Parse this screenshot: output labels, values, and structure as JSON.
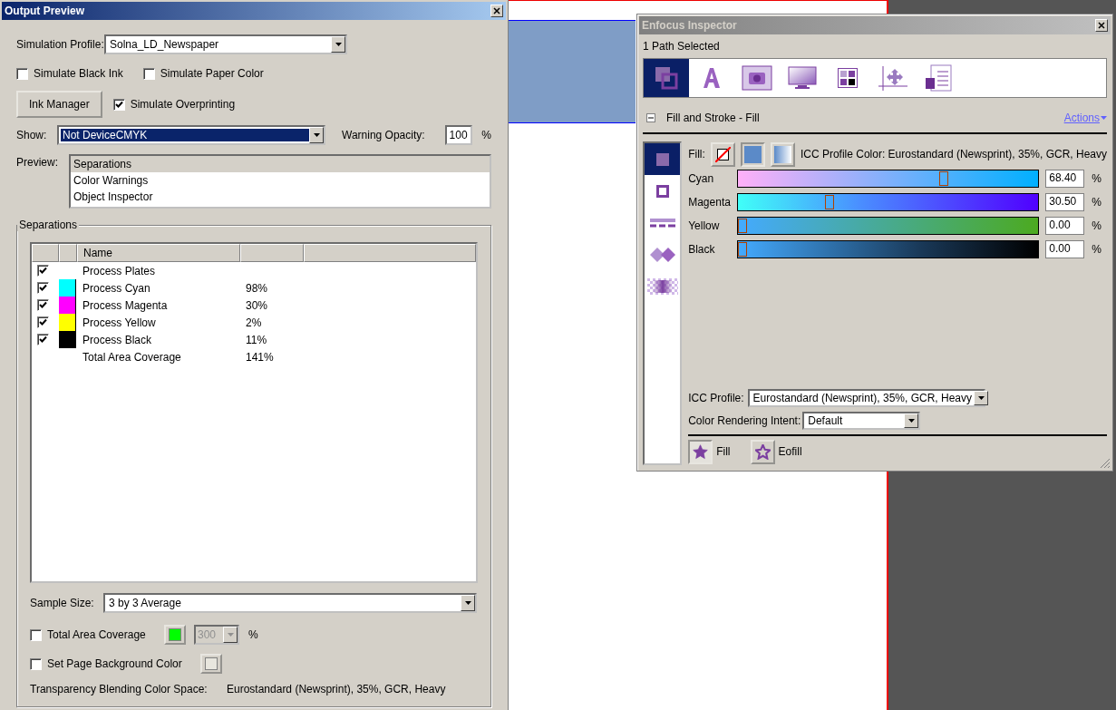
{
  "output_preview": {
    "title": "Output Preview",
    "simulation_profile": {
      "label": "Simulation Profile:",
      "value": "Solna_LD_Newspaper"
    },
    "simulate_options": [
      {
        "label": "Simulate Black Ink",
        "checked": false
      },
      {
        "label": "Simulate Paper Color",
        "checked": false
      }
    ],
    "ink_manager": "Ink Manager",
    "simulate_overprinting": {
      "label": "Simulate Overprinting",
      "checked": true
    },
    "show": {
      "label": "Show:",
      "value": "Not DeviceCMYK"
    },
    "warning_opacity": {
      "label": "Warning Opacity:",
      "value": "100",
      "unit": "%"
    },
    "preview": {
      "label": "Preview:",
      "items": [
        {
          "label": "Separations",
          "selected": true
        },
        {
          "label": "Color Warnings",
          "selected": false
        },
        {
          "label": "Object Inspector",
          "selected": false
        }
      ]
    },
    "separations": {
      "title": "Separations",
      "columns": [
        "Name"
      ],
      "rows": [
        {
          "checked": true,
          "name": "Process Plates",
          "value": ""
        },
        {
          "checked": true,
          "color": "#00ffff",
          "name": "Process Cyan",
          "value": "98%"
        },
        {
          "checked": true,
          "color": "#ff00ff",
          "name": "Process Magenta",
          "value": "30%"
        },
        {
          "checked": true,
          "color": "#ffff00",
          "name": "Process Yellow",
          "value": "2%"
        },
        {
          "checked": true,
          "color": "#000000",
          "name": "Process Black",
          "value": "11%"
        },
        {
          "kind": "total",
          "name": "Total Area Coverage",
          "value": "141%"
        }
      ]
    },
    "sample_size": {
      "label": "Sample Size:",
      "value": "3 by 3 Average"
    },
    "total_area_coverage": {
      "label": "Total Area Coverage",
      "checked": false,
      "color": "#00ff00",
      "value": "300",
      "unit": "%"
    },
    "page_background": {
      "label": "Set Page Background Color",
      "checked": false,
      "color": "#e8e6de"
    },
    "blending": {
      "label": "Transparency Blending Color Space:",
      "value": "Eurostandard (Newsprint), 35%, GCR, Heavy"
    }
  },
  "inspector": {
    "title": "Enfocus Inspector",
    "status": "1 Path Selected",
    "tools": [
      {
        "kind": "fill-stroke",
        "selected": true
      },
      {
        "kind": "text",
        "selected": false
      },
      {
        "kind": "image",
        "selected": false
      },
      {
        "kind": "monitor",
        "selected": false
      },
      {
        "kind": "swatches",
        "selected": false
      },
      {
        "kind": "position",
        "selected": false
      },
      {
        "kind": "info",
        "selected": false
      }
    ],
    "section": {
      "title": "Fill and Stroke - Fill",
      "action": "Actions",
      "expanded": true
    },
    "side_tabs": [
      {
        "kind": "fill",
        "selected": true
      },
      {
        "kind": "stroke",
        "selected": false
      },
      {
        "kind": "dash",
        "selected": false
      },
      {
        "kind": "overlap",
        "selected": false
      },
      {
        "kind": "transparency",
        "selected": false
      }
    ],
    "fill_label": "Fill:",
    "fill_types": [
      {
        "kind": "none",
        "selected": false
      },
      {
        "kind": "solid",
        "selected": true
      },
      {
        "kind": "gradient",
        "selected": false
      }
    ],
    "profile_color": "ICC Profile Color: Eurostandard (Newsprint), 35%, GCR, Heavy",
    "channels": [
      {
        "name": "Cyan",
        "level": 0.684,
        "reading": "68.40",
        "unit": "%"
      },
      {
        "name": "Magenta",
        "level": 0.305,
        "reading": "30.50",
        "unit": "%"
      },
      {
        "name": "Yellow",
        "level": 0,
        "reading": "0.00",
        "unit": "%"
      },
      {
        "name": "Black",
        "level": 0,
        "reading": "0.00",
        "unit": "%"
      }
    ],
    "icc_profile": {
      "label": "ICC Profile:",
      "value": "Eurostandard (Newsprint), 35%, GCR, Heavy"
    },
    "rendering_intent": {
      "label": "Color Rendering Intent:",
      "value": "Default"
    },
    "fill_rules": [
      {
        "kind": "nonzero",
        "label": "Fill",
        "selected": true
      },
      {
        "kind": "evenodd",
        "label": "Eofill",
        "selected": false
      }
    ]
  }
}
